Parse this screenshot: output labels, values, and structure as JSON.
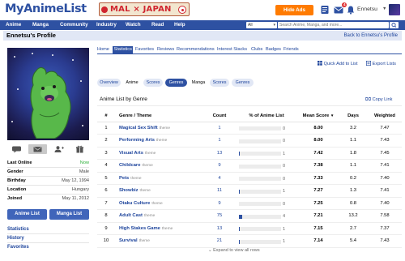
{
  "header": {
    "logo": "MyAnimeList",
    "banner_text": "MAL × JAPAN",
    "hide_ads": "Hide Ads",
    "mail_badge": "4",
    "username": "Ennetsu",
    "icons": [
      "list-icon",
      "mail-icon",
      "bell-icon"
    ]
  },
  "nav": {
    "items": [
      "Anime",
      "Manga",
      "Community",
      "Industry",
      "Watch",
      "Read",
      "Help"
    ],
    "search_scope": "All",
    "search_placeholder": "Search Anime, Manga, and more..."
  },
  "profile_bar": {
    "title": "Ennetsu's Profile",
    "back_link": "Back to Ennetsu's Profile"
  },
  "sidebar": {
    "action_icons": [
      "comment-icon",
      "mail-icon",
      "add-friend-icon",
      "gift-icon"
    ],
    "info": [
      {
        "label": "Last Online",
        "value": "Now"
      },
      {
        "label": "Gender",
        "value": "Male"
      },
      {
        "label": "Birthday",
        "value": "May 12, 1994"
      },
      {
        "label": "Location",
        "value": "Hungary"
      },
      {
        "label": "Joined",
        "value": "May 11, 2012"
      }
    ],
    "buttons": [
      "Anime List",
      "Manga List"
    ],
    "links": [
      "Statistics",
      "History",
      "Favorites"
    ]
  },
  "profile_tabs": [
    "Home",
    "Statistics",
    "Favorites",
    "Reviews",
    "Recommendations",
    "Interest Stacks",
    "Clubs",
    "Badges",
    "Friends"
  ],
  "active_profile_tab": "Statistics",
  "toolbar": {
    "quick_add": "Quick Add to List",
    "export": "Export Lists"
  },
  "sub_tabs": [
    "Overview",
    "Anime",
    "Scores",
    "Genres",
    "Manga",
    "Scores",
    "Genres"
  ],
  "active_sub_tab": "Genres",
  "section": {
    "title": "Anime List by Genre",
    "copy_link": "Copy Link"
  },
  "table": {
    "headers": [
      "#",
      "Genre / Theme",
      "Count",
      "% of Anime List",
      "Mean Score",
      "Days",
      "Weighted"
    ],
    "rows": [
      {
        "rank": "1",
        "name": "Magical Sex Shift",
        "tag": "theme",
        "count": "1",
        "pct": 0,
        "pct_label": "0",
        "mean": "8.00",
        "days": "3.2",
        "weighted": "7.47"
      },
      {
        "rank": "2",
        "name": "Performing Arts",
        "tag": "theme",
        "count": "1",
        "pct": 0,
        "pct_label": "0",
        "mean": "8.00",
        "days": "1.1",
        "weighted": "7.43"
      },
      {
        "rank": "3",
        "name": "Visual Arts",
        "tag": "theme",
        "count": "13",
        "pct": 1,
        "pct_label": "1",
        "mean": "7.42",
        "days": "1.8",
        "weighted": "7.45"
      },
      {
        "rank": "4",
        "name": "Childcare",
        "tag": "theme",
        "count": "9",
        "pct": 0,
        "pct_label": "0",
        "mean": "7.38",
        "days": "1.1",
        "weighted": "7.41"
      },
      {
        "rank": "5",
        "name": "Pets",
        "tag": "theme",
        "count": "4",
        "pct": 0,
        "pct_label": "0",
        "mean": "7.33",
        "days": "0.2",
        "weighted": "7.40"
      },
      {
        "rank": "6",
        "name": "Showbiz",
        "tag": "theme",
        "count": "11",
        "pct": 1,
        "pct_label": "1",
        "mean": "7.27",
        "days": "1.3",
        "weighted": "7.41"
      },
      {
        "rank": "7",
        "name": "Otaku Culture",
        "tag": "theme",
        "count": "9",
        "pct": 0,
        "pct_label": "0",
        "mean": "7.25",
        "days": "0.8",
        "weighted": "7.40"
      },
      {
        "rank": "8",
        "name": "Adult Cast",
        "tag": "theme",
        "count": "75",
        "pct": 4,
        "pct_label": "4",
        "mean": "7.21",
        "days": "13.2",
        "weighted": "7.58"
      },
      {
        "rank": "9",
        "name": "High Stakes Game",
        "tag": "theme",
        "count": "13",
        "pct": 1,
        "pct_label": "1",
        "mean": "7.15",
        "days": "2.7",
        "weighted": "7.37"
      },
      {
        "rank": "10",
        "name": "Survival",
        "tag": "theme",
        "count": "21",
        "pct": 1,
        "pct_label": "1",
        "mean": "7.14",
        "days": "5.4",
        "weighted": "7.43"
      }
    ],
    "expand": "Expand to view all rows"
  },
  "colors": {
    "brand": "#2e51a2",
    "link": "#1c439b",
    "online": "#2db039",
    "hide_ads": "#ff7b00",
    "tab_bg": "#e1e7f5"
  }
}
